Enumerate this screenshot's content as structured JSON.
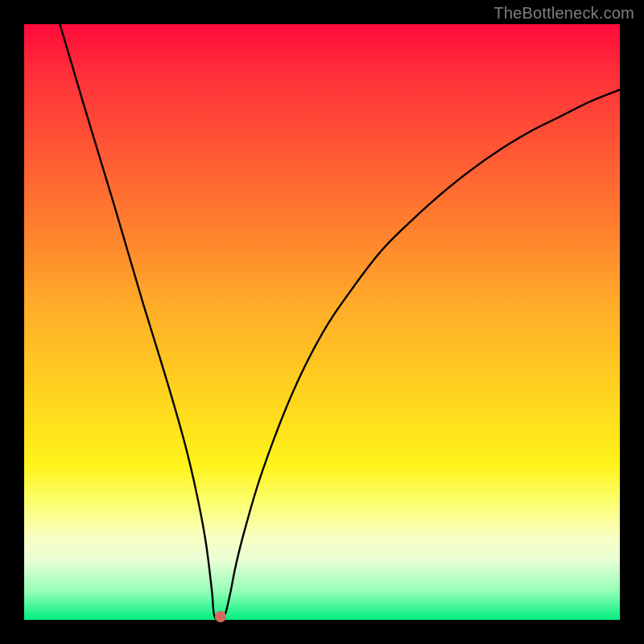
{
  "watermark": "TheBottleneck.com",
  "colors": {
    "frame": "#000000",
    "gradient_top": "#ff0a3a",
    "gradient_bottom": "#02ef81",
    "curve": "#000000",
    "marker": "#d46a5f"
  },
  "chart_data": {
    "type": "line",
    "title": "",
    "xlabel": "",
    "ylabel": "",
    "xlim": [
      0,
      100
    ],
    "ylim": [
      0,
      100
    ],
    "grid": false,
    "legend": false,
    "series": [
      {
        "name": "bottleneck-curve",
        "x": [
          6,
          10,
          15,
          20,
          24,
          27,
          29,
          30.5,
          31.5,
          32,
          33.5,
          34.5,
          35.5,
          37,
          40,
          45,
          50,
          55,
          60,
          65,
          70,
          75,
          80,
          85,
          90,
          95,
          100
        ],
        "values": [
          100,
          86.5,
          70,
          53,
          40,
          29.5,
          21,
          13,
          5,
          0.5,
          0.5,
          4,
          9,
          15,
          25,
          38,
          48,
          55.5,
          62,
          67,
          71.5,
          75.5,
          79,
          82,
          84.5,
          87,
          89
        ]
      }
    ],
    "marker": {
      "x": 33.0,
      "y": 0.5
    },
    "axes_visible": false
  }
}
